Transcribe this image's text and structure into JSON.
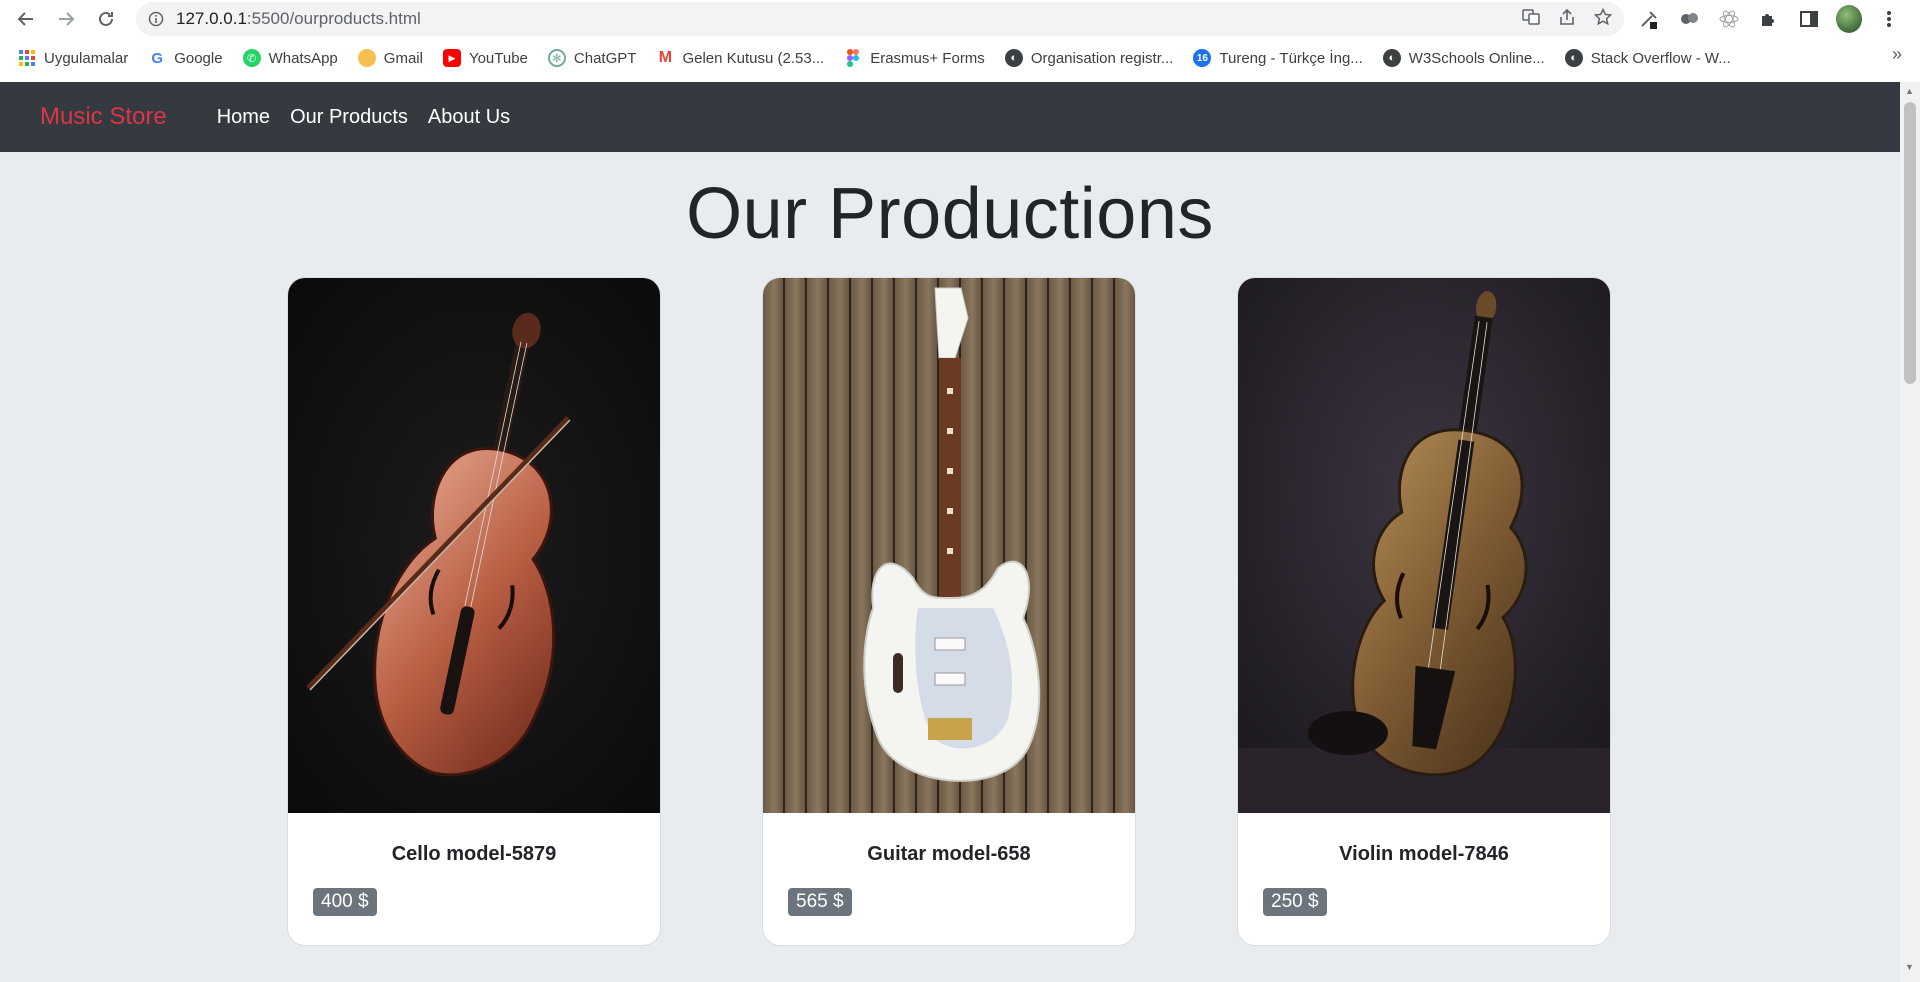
{
  "browser": {
    "url_host": "127.0.0.1",
    "url_path": ":5500/ourproducts.html",
    "bookmarks": [
      {
        "label": "Uygulamalar",
        "color": "#4285f4"
      },
      {
        "label": "Google",
        "color": "#ffffff"
      },
      {
        "label": "WhatsApp",
        "color": "#25d366"
      },
      {
        "label": "Gmail",
        "color": "#f6bf4f"
      },
      {
        "label": "YouTube",
        "color": "#ff0000"
      },
      {
        "label": "ChatGPT",
        "color": "#74aa9c"
      },
      {
        "label": "Gelen Kutusu (2.53...",
        "color": "#ea4335"
      },
      {
        "label": "Erasmus+ Forms",
        "color": "#a259ff"
      },
      {
        "label": "Organisation registr...",
        "color": "#3c4043"
      },
      {
        "label": "Tureng - Türkçe İng...",
        "color": "#1a73e8"
      },
      {
        "label": "W3Schools Online...",
        "color": "#3c4043"
      },
      {
        "label": "Stack Overflow - W...",
        "color": "#3c4043"
      }
    ],
    "tureng_badge": "16",
    "more": "»"
  },
  "site": {
    "brand": "Music Store",
    "nav": [
      "Home",
      "Our Products",
      "About Us"
    ],
    "heading": "Our Productions",
    "products": [
      {
        "name": "Cello model-5879",
        "price": "400 $",
        "image": "cello"
      },
      {
        "name": "Guitar model-658",
        "price": "565 $",
        "image": "guitar"
      },
      {
        "name": "Violin model-7846",
        "price": "250 $",
        "image": "violin"
      }
    ]
  },
  "colors": {
    "navbar": "#343a40",
    "brand": "#dc3545",
    "page_bg": "#e9ecef",
    "badge": "#6c757d"
  }
}
